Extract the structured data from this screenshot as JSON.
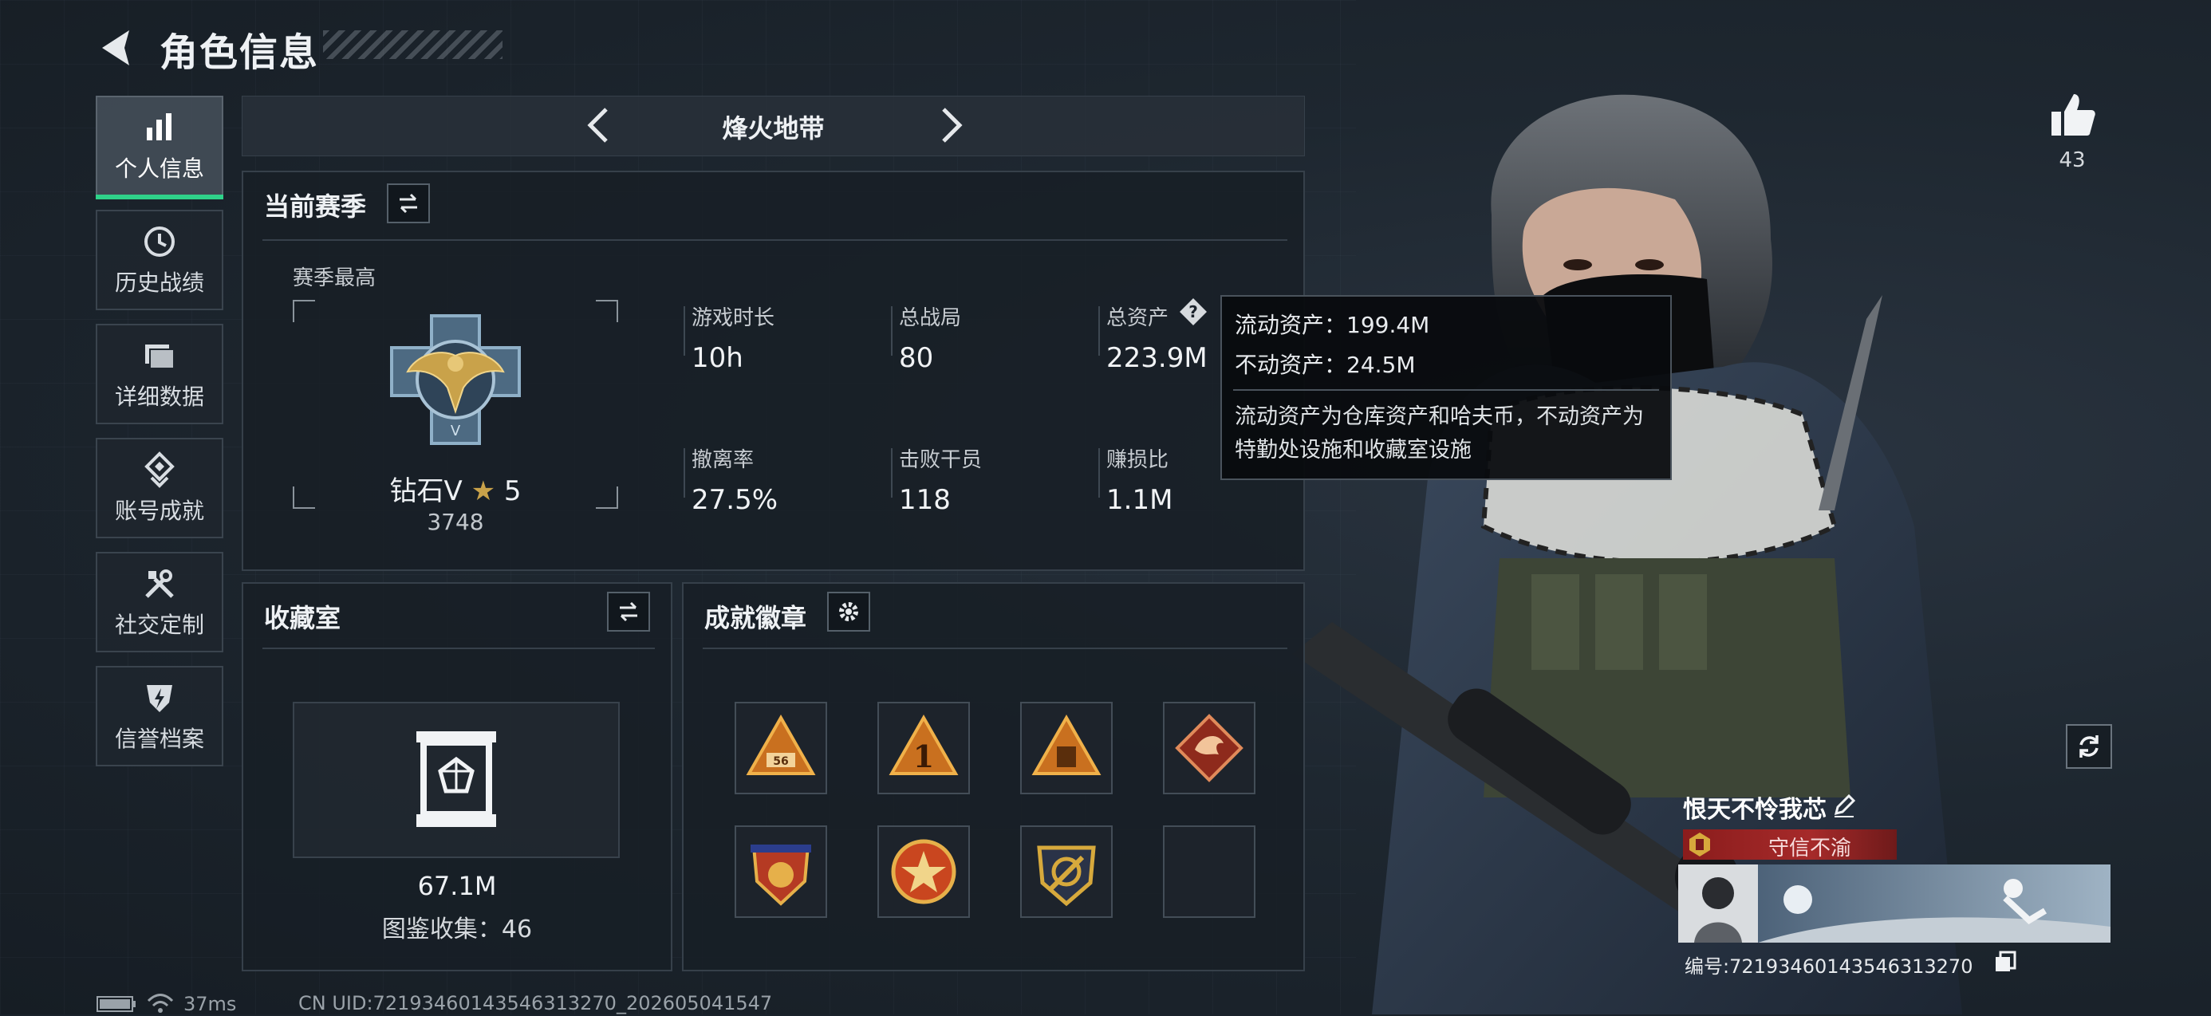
{
  "header": {
    "title": "角色信息"
  },
  "sidebar": {
    "items": [
      {
        "label": "个人信息",
        "icon": "bar-chart-icon",
        "active": true
      },
      {
        "label": "历史战绩",
        "icon": "history-icon",
        "active": false
      },
      {
        "label": "详细数据",
        "icon": "folder-icon",
        "active": false
      },
      {
        "label": "账号成就",
        "icon": "achievement-icon",
        "active": false
      },
      {
        "label": "社交定制",
        "icon": "tools-icon",
        "active": false
      },
      {
        "label": "信誉档案",
        "icon": "credit-icon",
        "active": false
      }
    ]
  },
  "mode": {
    "name": "烽火地带"
  },
  "season": {
    "title": "当前赛季",
    "best_label": "赛季最高",
    "rank_name": "钻石V",
    "rank_stars": "5",
    "rank_score": "3748",
    "stats": [
      {
        "label": "游戏时长",
        "value": "10h"
      },
      {
        "label": "总战局",
        "value": "80"
      },
      {
        "label": "总资产",
        "value": "223.9M"
      },
      {
        "label": "撤离率",
        "value": "27.5%"
      },
      {
        "label": "击败干员",
        "value": "118"
      },
      {
        "label": "赚损比",
        "value": "1.1M"
      }
    ]
  },
  "tooltip": {
    "liquid": "流动资产：199.4M",
    "fixed": "不动资产：24.5M",
    "desc": "流动资产为仓库资产和哈夫币，不动资产为特勤处设施和收藏室设施"
  },
  "vault": {
    "title": "收藏室",
    "value": "67.1M",
    "collection": "图鉴收集：46"
  },
  "badges": {
    "title": "成就徽章",
    "items": [
      "triangle-56-badge",
      "triangle-1-badge",
      "triangle-bell-badge",
      "dragon-badge",
      "shield-badge",
      "star-medal-badge",
      "crest-badge",
      "empty-slot"
    ]
  },
  "profile": {
    "likes": "43",
    "player_name": "恨天不怜我芯",
    "title": "守信不渝",
    "id": "编号:7219346014354631327​0"
  },
  "status": {
    "ping": "37ms",
    "uid": "CN UID:7219346014354631327​0_202605041547"
  },
  "colors": {
    "accent": "#2fd28a",
    "title_red": "#a62a2a",
    "gold": "#c9a24a"
  }
}
